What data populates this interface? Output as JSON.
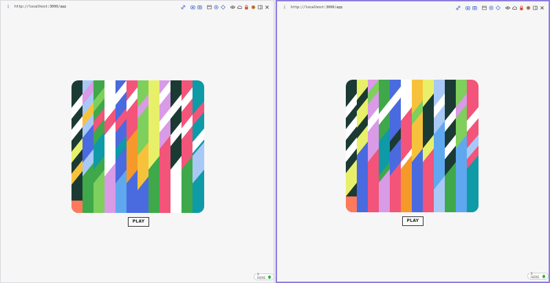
{
  "left": {
    "url": "http://localhost:3000/app",
    "play_label": "PLAY",
    "presence_label": "2 HERE"
  },
  "right": {
    "url": "http://localhost:3000/app",
    "play_label": "PLAY"
  },
  "toolbar_icons": [
    "link-icon",
    "camera-icon",
    "screenshot-icon",
    "window-icon",
    "globe-icon",
    "target-icon",
    "eye-icon",
    "cloud-icon",
    "lock-icon",
    "puzzle-icon",
    "sidebar-icon",
    "close-icon"
  ],
  "art": {
    "background": "#f6f6f6",
    "palette": [
      "#1b3a33",
      "#ffffff",
      "#e8f06a",
      "#4a6ae0",
      "#f2547a",
      "#7ecf5c",
      "#d99ae6",
      "#f7c23b",
      "#3ea84b",
      "#0e9aa7",
      "#5fa8f0",
      "#f59a2a",
      "#a8c8f6",
      "#ff7a5c",
      "#2f8f4e"
    ]
  }
}
